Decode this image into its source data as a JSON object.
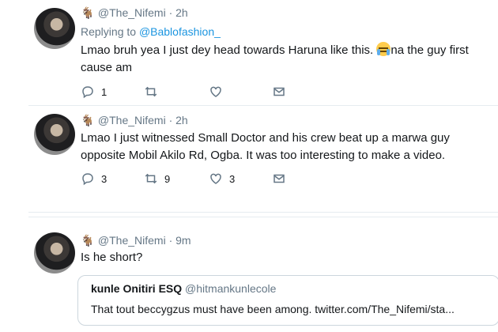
{
  "tweets": [
    {
      "emoji": "🐐",
      "handle": "@The_Nifemi",
      "time": "· 2h",
      "replying_prefix": "Replying to ",
      "replying_handle": "@Bablofashion_",
      "text_before": "Lmao bruh yea I just dey head towards Haruna like this. ",
      "emoji_inline": "loudly-crying-face",
      "text_after": "na the guy first cause am",
      "replies": "1",
      "retweets": "",
      "likes": ""
    },
    {
      "emoji": "🐐",
      "handle": "@The_Nifemi",
      "time": "· 2h",
      "text": "Lmao I just witnessed Small Doctor and his crew beat up a marwa guy opposite Mobil Akilo Rd, Ogba.  It was too interesting to make a video.",
      "replies": "3",
      "retweets": "9",
      "likes": "3"
    },
    {
      "emoji": "🐐",
      "handle": "@The_Nifemi",
      "time": "· 9m",
      "text": "Is he short?",
      "quote": {
        "name": "kunle Onitiri ESQ",
        "handle": "@hitmankunlecole",
        "text": "That tout beccygzus must have been among. twitter.com/The_Nifemi/sta..."
      }
    }
  ],
  "colors": {
    "muted": "#657786",
    "link": "#1b95e0",
    "text": "#14171a",
    "divider": "#e6ecf0"
  }
}
